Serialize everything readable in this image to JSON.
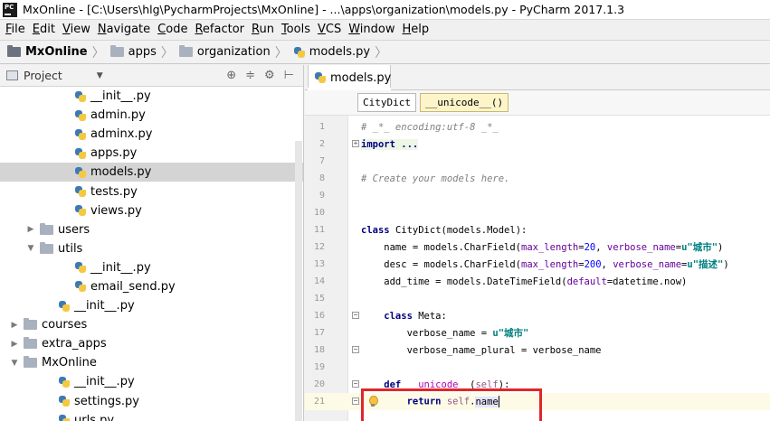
{
  "window": {
    "title": "MxOnline - [C:\\Users\\hlg\\PycharmProjects\\MxOnline] - ...\\apps\\organization\\models.py - PyCharm 2017.1.3",
    "icon_text": "PC"
  },
  "menu": [
    {
      "u": "F",
      "rest": "ile"
    },
    {
      "u": "E",
      "rest": "dit"
    },
    {
      "u": "V",
      "rest": "iew"
    },
    {
      "u": "N",
      "rest": "avigate"
    },
    {
      "u": "C",
      "rest": "ode"
    },
    {
      "u": "R",
      "rest": "efactor"
    },
    {
      "u": "R",
      "rest": "un"
    },
    {
      "u": "T",
      "rest": "ools"
    },
    {
      "u": "V",
      "rest": "CS"
    },
    {
      "u": "W",
      "rest": "indow"
    },
    {
      "u": "H",
      "rest": "elp"
    }
  ],
  "navbar": {
    "project": "MxOnline",
    "folder1": "apps",
    "folder2": "organization",
    "file": "models.py"
  },
  "project_panel": {
    "title": "Project",
    "tools": [
      "⊕",
      "≑",
      "⚙",
      "⊢"
    ]
  },
  "tree": [
    {
      "label": "__init__.py",
      "kind": "py",
      "indent": 82,
      "arrow": ""
    },
    {
      "label": "admin.py",
      "kind": "py",
      "indent": 82,
      "arrow": ""
    },
    {
      "label": "adminx.py",
      "kind": "py",
      "indent": 82,
      "arrow": ""
    },
    {
      "label": "apps.py",
      "kind": "py",
      "indent": 82,
      "arrow": ""
    },
    {
      "label": "models.py",
      "kind": "py",
      "indent": 82,
      "arrow": "",
      "selected": true
    },
    {
      "label": "tests.py",
      "kind": "py",
      "indent": 82,
      "arrow": ""
    },
    {
      "label": "views.py",
      "kind": "py",
      "indent": 82,
      "arrow": ""
    },
    {
      "label": "users",
      "kind": "folder",
      "indent": 44,
      "arrow": "▶"
    },
    {
      "label": "utils",
      "kind": "folder",
      "indent": 44,
      "arrow": "▼"
    },
    {
      "label": "__init__.py",
      "kind": "py",
      "indent": 82,
      "arrow": ""
    },
    {
      "label": "email_send.py",
      "kind": "py",
      "indent": 82,
      "arrow": ""
    },
    {
      "label": "__init__.py",
      "kind": "py",
      "indent": 64,
      "arrow": ""
    },
    {
      "label": "courses",
      "kind": "folder",
      "indent": 26,
      "arrow": "▶"
    },
    {
      "label": "extra_apps",
      "kind": "folder",
      "indent": 26,
      "arrow": "▶"
    },
    {
      "label": "MxOnline",
      "kind": "folder",
      "indent": 26,
      "arrow": "▼"
    },
    {
      "label": "__init__.py",
      "kind": "py",
      "indent": 64,
      "arrow": ""
    },
    {
      "label": "settings.py",
      "kind": "py",
      "indent": 64,
      "arrow": ""
    },
    {
      "label": "urls.py",
      "kind": "py",
      "indent": 64,
      "arrow": ""
    }
  ],
  "editor": {
    "tab_label": "models.py",
    "breadcrumbs": [
      "CityDict",
      "__unicode__()"
    ],
    "line_numbers": [
      "1",
      "2",
      "7",
      "8",
      "9",
      "10",
      "11",
      "12",
      "13",
      "14",
      "15",
      "16",
      "17",
      "18",
      "19",
      "20",
      "21"
    ]
  },
  "code": {
    "l1": "# _*_ encoding:utf-8 _*_",
    "l2": "import ...",
    "l8": "# Create your models here.",
    "l10_kw": "class ",
    "l10_rest": "CityDict(models.Model):",
    "l11_a": "    name = models.CharField(",
    "l11_k1": "max_length",
    "l11_n1": "20",
    "l11_k2": "verbose_name",
    "l11_s": "u\"城市\"",
    "l12_a": "    desc = models.CharField(",
    "l12_k1": "max_length",
    "l12_n1": "200",
    "l12_k2": "verbose_name",
    "l12_s": "u\"描述\"",
    "l13_a": "    add_time = models.DateTimeField(",
    "l13_k": "default",
    "l13_b": "=datetime.now)",
    "l15_kw": "    class ",
    "l15_rest": "Meta:",
    "l16_a": "        verbose_name = ",
    "l16_s": "u\"城市\"",
    "l17": "        verbose_name_plural = verbose_name",
    "l19_kw": "    def ",
    "l19_fn": "__unicode__",
    "l19_p": "(",
    "l19_self": "self",
    "l19_e": "):",
    "l20_kw": "        return ",
    "l20_self": "self",
    "l20_dot": ".",
    "l20_name": "name"
  }
}
